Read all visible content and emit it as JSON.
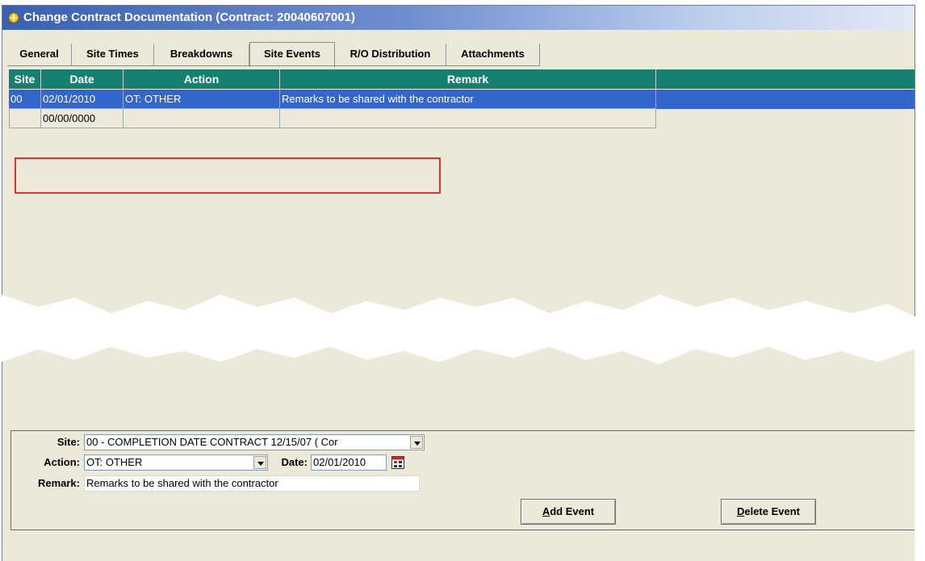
{
  "window": {
    "title": "Change Contract Documentation (Contract: 20040607001)"
  },
  "tabs": [
    {
      "label": "General"
    },
    {
      "label": "Site Times"
    },
    {
      "label": "Breakdowns"
    },
    {
      "label": "Site Events",
      "active": true
    },
    {
      "label": "R/O Distribution"
    },
    {
      "label": "Attachments"
    }
  ],
  "grid": {
    "columns": [
      "Site",
      "Date",
      "Action",
      "Remark"
    ],
    "rows": [
      {
        "site": "00",
        "date": "02/01/2010",
        "action": "OT: OTHER",
        "remark": "Remarks to be shared with the contractor",
        "selected": true
      },
      {
        "site": "",
        "date": "00/00/0000",
        "action": "",
        "remark": ""
      }
    ]
  },
  "form": {
    "site_label": "Site:",
    "site_value": "00 - COMPLETION DATE CONTRACT 12/15/07 ( Cor",
    "action_label": "Action:",
    "action_value": "OT: OTHER",
    "date_label": "Date:",
    "date_value": "02/01/2010",
    "remark_label": "Remark:",
    "remark_value": "Remarks to be shared with the contractor"
  },
  "buttons": {
    "add_first": "A",
    "add_rest": "dd Event",
    "delete_first": "D",
    "delete_rest": "elete Event"
  },
  "colors": {
    "grid_header": "#168170",
    "selected_row": "#3366cc",
    "highlight_box": "#e23030"
  }
}
